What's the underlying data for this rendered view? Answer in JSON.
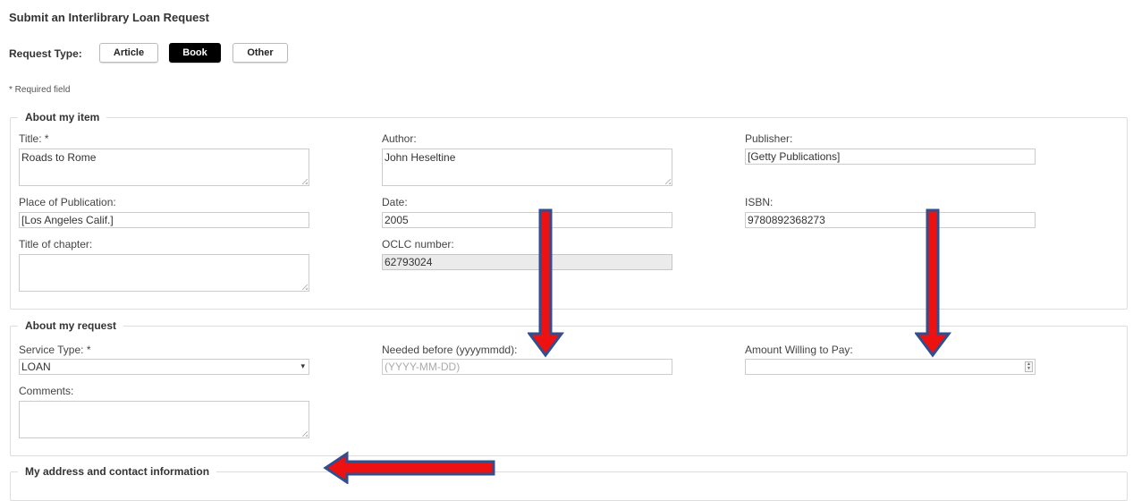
{
  "page": {
    "heading": "Submit an Interlibrary Loan Request",
    "request_type_label": "Request Type:",
    "request_types": [
      "Article",
      "Book",
      "Other"
    ],
    "selected_request_type": "Book",
    "required_note": "* Required field"
  },
  "item_section": {
    "legend": "About my item",
    "title_label": "Title: *",
    "title_value": "Roads to Rome",
    "author_label": "Author:",
    "author_value": "John Heseltine",
    "publisher_label": "Publisher:",
    "publisher_value": "[Getty Publications]",
    "place_label": "Place of Publication:",
    "place_value": "[Los Angeles  Calif.]",
    "date_label": "Date:",
    "date_value": "2005",
    "isbn_label": "ISBN:",
    "isbn_value": "9780892368273",
    "chapter_label": "Title of chapter:",
    "chapter_value": "",
    "oclc_label": "OCLC number:",
    "oclc_value": "62793024"
  },
  "request_section": {
    "legend": "About my request",
    "service_type_label": "Service Type: *",
    "service_type_value": "LOAN",
    "needed_before_label": "Needed before (yyyymmdd):",
    "needed_before_placeholder": "(YYYY-MM-DD)",
    "amount_label": "Amount Willing to Pay:",
    "amount_value": "",
    "comments_label": "Comments:",
    "comments_value": ""
  },
  "contact_section": {
    "legend": "My address and contact information"
  },
  "colors": {
    "annotation_arrow_fill": "#ee1111",
    "annotation_arrow_outline": "#2f4f8f",
    "active_button_bg": "#000000"
  }
}
